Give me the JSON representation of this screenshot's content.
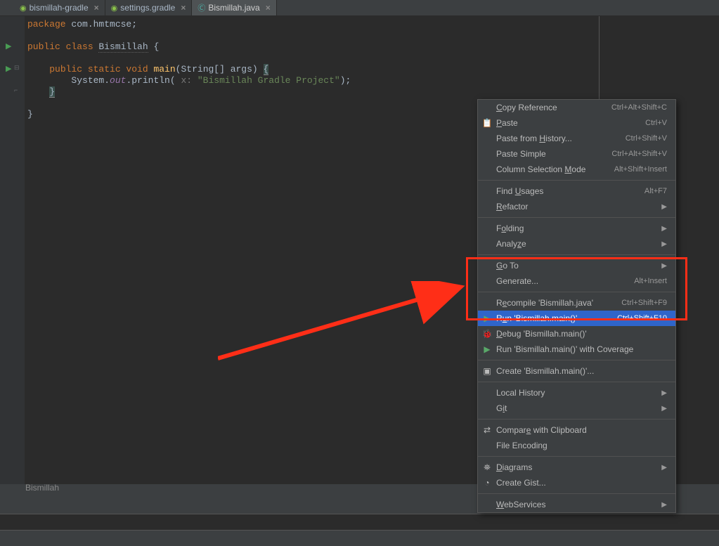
{
  "tabs": [
    {
      "label": "bismillah-gradle",
      "iconColor": "#8bc34a"
    },
    {
      "label": "settings.gradle",
      "iconColor": "#8bc34a"
    },
    {
      "label": "Bismillah.java",
      "iconColor": "#4db6ac",
      "active": true
    }
  ],
  "code": {
    "line1_pkg": "package",
    "line1_name": " com.hmtmcse;",
    "line3_pub": "public class ",
    "line3_cls": "Bismillah",
    "line3_brace": " {",
    "line5_mod": "public static void ",
    "line5_method": "main",
    "line5_open": "(",
    "line5_type": "String[] args",
    "line5_close": ") ",
    "line5_lbrace": "{",
    "line6_call1": "System.",
    "line6_out": "out",
    "line6_call2": ".println( ",
    "line6_x": "x: ",
    "line6_str": "\"Bismillah Gradle Project\"",
    "line6_end": ");",
    "line7_rbrace": "}",
    "line9_rbrace": "}"
  },
  "menu": {
    "copyRef": "Copy Reference",
    "copyRef_s": "Ctrl+Alt+Shift+C",
    "paste": "Paste",
    "paste_s": "Ctrl+V",
    "pasteHist": "Paste from History...",
    "pasteHist_s": "Ctrl+Shift+V",
    "pasteSimple": "Paste Simple",
    "pasteSimple_s": "Ctrl+Alt+Shift+V",
    "colSel": "Column Selection Mode",
    "colSel_s": "Alt+Shift+Insert",
    "findUsages": "Find Usages",
    "findUsages_s": "Alt+F7",
    "refactor": "Refactor",
    "folding": "Folding",
    "analyze": "Analyze",
    "goto": "Go To",
    "generate": "Generate...",
    "generate_s": "Alt+Insert",
    "recompile": "Recompile 'Bismillah.java'",
    "recompile_s": "Ctrl+Shift+F9",
    "run": "Run 'Bismillah.main()'",
    "run_s": "Ctrl+Shift+F10",
    "debug": "Debug 'Bismillah.main()'",
    "coverage": "Run 'Bismillah.main()' with Coverage",
    "createRun": "Create 'Bismillah.main()'...",
    "localHist": "Local History",
    "git": "Git",
    "compare": "Compare with Clipboard",
    "encoding": "File Encoding",
    "diagrams": "Diagrams",
    "gist": "Create Gist...",
    "webservices": "WebServices"
  },
  "breadcrumb": "Bismillah"
}
